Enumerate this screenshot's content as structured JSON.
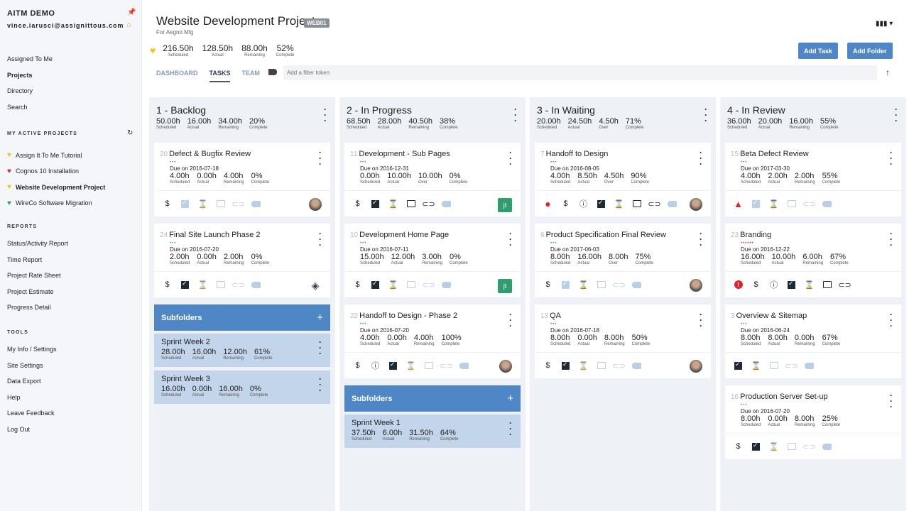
{
  "sidebar": {
    "brand": "AITM DEMO",
    "email": "vince.iarusci@assignittous.com",
    "nav": [
      {
        "label": "Assigned To Me"
      },
      {
        "label": "Projects",
        "active": true
      },
      {
        "label": "Directory"
      },
      {
        "label": "Search"
      }
    ],
    "active_projects_title": "MY ACTIVE PROJECTS",
    "projects": [
      {
        "label": "Assign It To Me Tutorial",
        "color": "#f2c21b"
      },
      {
        "label": "Cognos 10 Installation",
        "color": "#d9262e"
      },
      {
        "label": "Website Development Project",
        "color": "#f2c21b",
        "active": true
      },
      {
        "label": "WireCo Software Migration",
        "color": "#2fa84f"
      }
    ],
    "reports_title": "REPORTS",
    "reports": [
      "Status/Activity Report",
      "Time Report",
      "Project Rate Sheet",
      "Project Estimate",
      "Progress Detail"
    ],
    "tools_title": "TOOLS",
    "tools": [
      "My Info / Settings",
      "Site Settings",
      "Data Export",
      "Help",
      "Leave Feedback",
      "Log Out"
    ]
  },
  "header": {
    "title": "Website Development Project",
    "code": "WEB01",
    "client": "For Aegno Mfg",
    "health_color": "#f2c21b",
    "stats": [
      {
        "v": "216.50h",
        "l": "Scheduled"
      },
      {
        "v": "128.50h",
        "l": "Actual"
      },
      {
        "v": "88.00h",
        "l": "Remaining"
      },
      {
        "v": "52%",
        "l": "Complete"
      }
    ],
    "add_task": "Add Task",
    "add_folder": "Add Folder",
    "tabs": [
      {
        "label": "DASHBOARD"
      },
      {
        "label": "TASKS",
        "active": true
      },
      {
        "label": "TEAM"
      }
    ],
    "filter_placeholder": "Add a filter token"
  },
  "columns": [
    {
      "title": "1 - Backlog",
      "stats": [
        {
          "v": "50.00h",
          "l": "Scheduled"
        },
        {
          "v": "16.00h",
          "l": "Actual"
        },
        {
          "v": "34.00h",
          "l": "Remaining"
        },
        {
          "v": "20%",
          "l": "Complete"
        }
      ],
      "tasks": [
        {
          "num": "20",
          "name": "Defect & Bugfix Review",
          "priority": "green",
          "due": "Due on 2016-07-18",
          "stats": [
            {
              "v": "4.00h",
              "l": "Scheduled"
            },
            {
              "v": "0.00h",
              "l": "Actual"
            },
            {
              "v": "4.00h",
              "l": "Remaining"
            },
            {
              "v": "0%",
              "l": "Complete"
            }
          ],
          "icons": [
            [
              "dollar",
              1
            ],
            [
              "check",
              0
            ],
            [
              "hourglass",
              0
            ],
            [
              "comment",
              0
            ],
            [
              "clip",
              0
            ],
            [
              "tag",
              0
            ]
          ],
          "avatar": "photo"
        },
        {
          "num": "24",
          "name": "Final Site Launch Phase 2",
          "priority": "green",
          "due": "Due on 2016-07-20",
          "stats": [
            {
              "v": "2.00h",
              "l": "Scheduled"
            },
            {
              "v": "0.00h",
              "l": "Actual"
            },
            {
              "v": "2.00h",
              "l": "Remaining"
            },
            {
              "v": "0%",
              "l": "Complete"
            }
          ],
          "icons": [
            [
              "dollar",
              1
            ],
            [
              "check",
              1
            ],
            [
              "hourglass",
              0
            ],
            [
              "comment",
              0
            ],
            [
              "clip",
              0
            ],
            [
              "tag",
              0
            ]
          ],
          "avatar": "logo"
        }
      ],
      "subfolders_label": "Subfolders",
      "subfolders": [
        {
          "name": "Sprint Week 2",
          "stats": [
            {
              "v": "28.00h",
              "l": "Scheduled"
            },
            {
              "v": "16.00h",
              "l": "Actual"
            },
            {
              "v": "12.00h",
              "l": "Remaining"
            },
            {
              "v": "61%",
              "l": "Complete"
            }
          ]
        },
        {
          "name": "Sprint Week 3",
          "stats": [
            {
              "v": "16.00h",
              "l": "Scheduled"
            },
            {
              "v": "0.00h",
              "l": "Actual"
            },
            {
              "v": "16.00h",
              "l": "Remaining"
            },
            {
              "v": "0%",
              "l": "Complete"
            }
          ]
        }
      ]
    },
    {
      "title": "2 - In Progress",
      "stats": [
        {
          "v": "68.50h",
          "l": "Scheduled"
        },
        {
          "v": "28.00h",
          "l": "Actual"
        },
        {
          "v": "40.50h",
          "l": "Remaining"
        },
        {
          "v": "38%",
          "l": "Complete"
        }
      ],
      "tasks": [
        {
          "num": "11",
          "name": "Development - Sub Pages",
          "priority": "green",
          "due": "Due on 2016-12-31",
          "stats": [
            {
              "v": "0.00h",
              "l": "Scheduled"
            },
            {
              "v": "10.00h",
              "l": "Actual"
            },
            {
              "v": "10.00h",
              "l": "Over"
            },
            {
              "v": "0%",
              "l": "Complete"
            }
          ],
          "icons": [
            [
              "dollar",
              1
            ],
            [
              "check",
              1
            ],
            [
              "hourglass",
              1
            ],
            [
              "comment",
              1
            ],
            [
              "clip",
              1
            ],
            [
              "tag",
              0
            ]
          ],
          "avatar": "jt"
        },
        {
          "num": "10",
          "name": "Development Home Page",
          "priority": "green",
          "due": "Due on 2016-07-11",
          "stats": [
            {
              "v": "15.00h",
              "l": "Scheduled"
            },
            {
              "v": "12.00h",
              "l": "Actual"
            },
            {
              "v": "3.00h",
              "l": "Remaining"
            },
            {
              "v": "0%",
              "l": "Complete"
            }
          ],
          "icons": [
            [
              "dollar",
              1
            ],
            [
              "check",
              1
            ],
            [
              "hourglass",
              1
            ],
            [
              "comment",
              0
            ],
            [
              "clip",
              0
            ],
            [
              "tag",
              0
            ]
          ],
          "avatar": "jt"
        },
        {
          "num": "22",
          "name": "Handoff to Design - Phase 2",
          "priority": "green",
          "due": "Due on 2016-07-20",
          "stats": [
            {
              "v": "4.00h",
              "l": "Scheduled"
            },
            {
              "v": "0.00h",
              "l": "Actual"
            },
            {
              "v": "4.00h",
              "l": "Remaining"
            },
            {
              "v": "100%",
              "l": "Complete"
            }
          ],
          "icons": [
            [
              "dollar",
              1
            ],
            [
              "info",
              1
            ],
            [
              "check",
              1
            ],
            [
              "hourglass",
              0
            ],
            [
              "comment",
              0
            ],
            [
              "clip",
              0
            ],
            [
              "tag",
              0
            ]
          ],
          "avatar": "photo"
        }
      ],
      "subfolders_label": "Subfolders",
      "subfolders": [
        {
          "name": "Sprint Week 1",
          "stats": [
            {
              "v": "37.50h",
              "l": "Scheduled"
            },
            {
              "v": "6.00h",
              "l": "Actual"
            },
            {
              "v": "31.50h",
              "l": "Remaining"
            },
            {
              "v": "64%",
              "l": "Complete"
            }
          ]
        }
      ]
    },
    {
      "title": "3 - In Waiting",
      "stats": [
        {
          "v": "20.00h",
          "l": "Scheduled"
        },
        {
          "v": "24.50h",
          "l": "Actual"
        },
        {
          "v": "4.50h",
          "l": "Over"
        },
        {
          "v": "71%",
          "l": "Complete"
        }
      ],
      "tasks": [
        {
          "num": "7",
          "name": "Handoff to Design",
          "priority": "green",
          "due": "Due on 2016-08-05",
          "stats": [
            {
              "v": "4.00h",
              "l": "Scheduled"
            },
            {
              "v": "8.50h",
              "l": "Actual"
            },
            {
              "v": "4.50h",
              "l": "Over"
            },
            {
              "v": "90%",
              "l": "Complete"
            }
          ],
          "icons": [
            [
              "red-dot",
              1
            ],
            [
              "dollar",
              1
            ],
            [
              "info",
              1
            ],
            [
              "check",
              1
            ],
            [
              "hourglass",
              1
            ],
            [
              "comment",
              1
            ],
            [
              "clip",
              1
            ],
            [
              "tag",
              0
            ]
          ],
          "avatar": "photo"
        },
        {
          "num": "6",
          "name": "Product Specification Final Review",
          "priority": "green",
          "due": "Due on 2017-06-03",
          "stats": [
            {
              "v": "8.00h",
              "l": "Scheduled"
            },
            {
              "v": "16.00h",
              "l": "Actual"
            },
            {
              "v": "8.00h",
              "l": "Over"
            },
            {
              "v": "75%",
              "l": "Complete"
            }
          ],
          "icons": [
            [
              "dollar",
              1
            ],
            [
              "check",
              0
            ],
            [
              "hourglass",
              1
            ],
            [
              "comment",
              0
            ],
            [
              "clip",
              0
            ],
            [
              "tag",
              0
            ]
          ],
          "avatar": "photo"
        },
        {
          "num": "13",
          "name": "QA",
          "priority": "green",
          "due": "Due on 2016-07-18",
          "stats": [
            {
              "v": "8.00h",
              "l": "Scheduled"
            },
            {
              "v": "0.00h",
              "l": "Actual"
            },
            {
              "v": "8.00h",
              "l": "Remaining"
            },
            {
              "v": "50%",
              "l": "Complete"
            }
          ],
          "icons": [
            [
              "dollar",
              1
            ],
            [
              "check",
              1
            ],
            [
              "hourglass",
              0
            ],
            [
              "comment",
              0
            ],
            [
              "clip",
              0
            ],
            [
              "tag",
              0
            ]
          ],
          "avatar": "photo"
        }
      ]
    },
    {
      "title": "4 - In Review",
      "stats": [
        {
          "v": "36.00h",
          "l": "Scheduled"
        },
        {
          "v": "20.00h",
          "l": "Actual"
        },
        {
          "v": "16.00h",
          "l": "Remaining"
        },
        {
          "v": "55%",
          "l": "Complete"
        }
      ],
      "tasks": [
        {
          "num": "15",
          "name": "Beta Defect Review",
          "priority": "green",
          "due": "Due on 2017-03-30",
          "stats": [
            {
              "v": "4.00h",
              "l": "Scheduled"
            },
            {
              "v": "2.00h",
              "l": "Actual"
            },
            {
              "v": "2.00h",
              "l": "Remaining"
            },
            {
              "v": "55%",
              "l": "Complete"
            }
          ],
          "icons": [
            [
              "red-triangle",
              1
            ],
            [
              "check",
              0
            ],
            [
              "hourglass",
              1
            ],
            [
              "comment",
              0
            ],
            [
              "clip",
              0
            ],
            [
              "tag",
              0
            ]
          ]
        },
        {
          "num": "23",
          "name": "Branding",
          "priority": "red",
          "due": "Due on 2016-12-22",
          "stats": [
            {
              "v": "16.00h",
              "l": "Scheduled"
            },
            {
              "v": "10.00h",
              "l": "Actual"
            },
            {
              "v": "6.00h",
              "l": "Remaining"
            },
            {
              "v": "67%",
              "l": "Complete"
            }
          ],
          "icons": [
            [
              "red-alert",
              1
            ],
            [
              "dollar",
              1
            ],
            [
              "info",
              1
            ],
            [
              "check",
              1
            ],
            [
              "hourglass",
              1
            ],
            [
              "comment",
              1
            ],
            [
              "clip",
              1
            ]
          ]
        },
        {
          "num": "3",
          "name": "Overview & Sitemap",
          "priority": "green",
          "due": "Due on 2016-06-24",
          "stats": [
            {
              "v": "8.00h",
              "l": "Scheduled"
            },
            {
              "v": "8.00h",
              "l": "Actual"
            },
            {
              "v": "0.00h",
              "l": "Remaining"
            },
            {
              "v": "67%",
              "l": "Complete"
            }
          ],
          "icons": [
            [
              "check",
              1
            ],
            [
              "hourglass",
              1
            ],
            [
              "comment",
              0
            ],
            [
              "clip",
              0
            ],
            [
              "tag",
              0
            ]
          ]
        },
        {
          "num": "16",
          "name": "Production Server Set-up",
          "priority": "green",
          "due": "Due on 2016-07-20",
          "stats": [
            {
              "v": "8.00h",
              "l": "Scheduled"
            },
            {
              "v": "0.00h",
              "l": "Actual"
            },
            {
              "v": "8.00h",
              "l": "Remaining"
            },
            {
              "v": "25%",
              "l": "Complete"
            }
          ],
          "icons": [
            [
              "dollar",
              1
            ],
            [
              "check",
              1
            ],
            [
              "hourglass",
              0
            ],
            [
              "comment",
              0
            ],
            [
              "clip",
              0
            ],
            [
              "tag",
              0
            ]
          ]
        }
      ]
    }
  ]
}
